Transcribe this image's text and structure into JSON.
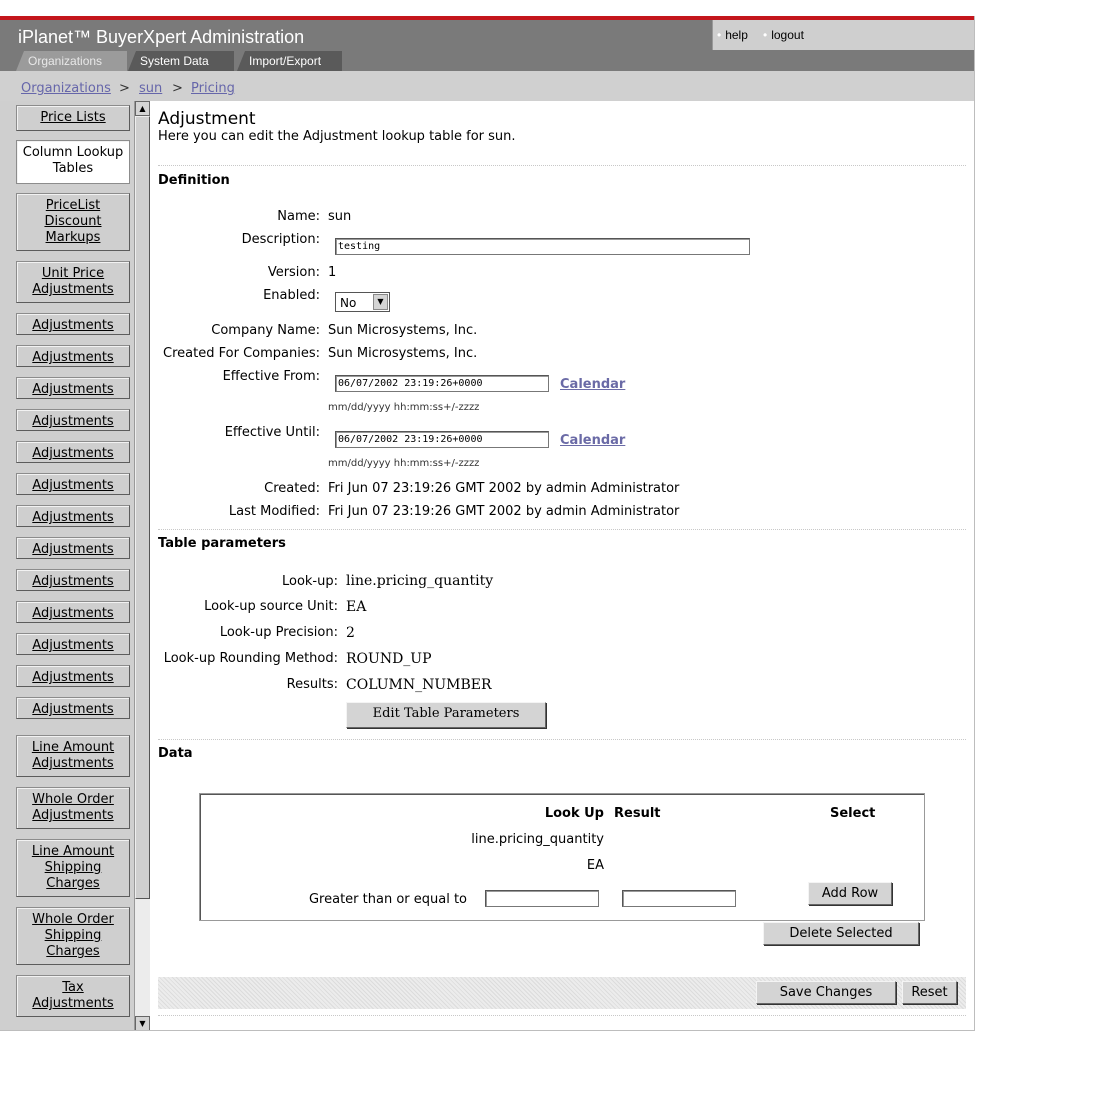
{
  "header": {
    "title": "iPlanet™ BuyerXpert Administration",
    "help": "help",
    "logout": "logout",
    "tabs": [
      "Organizations",
      "System Data",
      "Import/Export"
    ]
  },
  "breadcrumb": [
    "Organizations",
    "sun",
    "Pricing"
  ],
  "breadcrumb_sep": ">",
  "sidebar": [
    [
      "Price Lists"
    ],
    [
      "Column Lookup",
      "Tables"
    ],
    [
      "PriceList",
      "Discount",
      "Markups"
    ],
    [
      "Unit Price",
      "Adjustments"
    ],
    [
      "Adjustments"
    ],
    [
      "Adjustments"
    ],
    [
      "Adjustments"
    ],
    [
      "Adjustments"
    ],
    [
      "Adjustments"
    ],
    [
      "Adjustments"
    ],
    [
      "Adjustments"
    ],
    [
      "Adjustments"
    ],
    [
      "Adjustments"
    ],
    [
      "Adjustments"
    ],
    [
      "Adjustments"
    ],
    [
      "Adjustments"
    ],
    [
      "Adjustments"
    ],
    [
      "Line Amount",
      "Adjustments"
    ],
    [
      "Whole Order",
      "Adjustments"
    ],
    [
      "Line Amount",
      "Shipping",
      "Charges"
    ],
    [
      "Whole Order",
      "Shipping",
      "Charges"
    ],
    [
      "Tax",
      "Adjustments"
    ]
  ],
  "page": {
    "title": "Adjustment",
    "intro": "Here you can edit the Adjustment lookup table for sun."
  },
  "definition": {
    "heading": "Definition",
    "name_label": "Name:",
    "name": "sun",
    "description_label": "Description:",
    "description": "testing",
    "version_label": "Version:",
    "version": "1",
    "enabled_label": "Enabled:",
    "enabled": "No",
    "company_label": "Company Name:",
    "company": "Sun Microsystems, Inc.",
    "created_for_label": "Created For Companies:",
    "created_for": "Sun Microsystems, Inc.",
    "effective_from_label": "Effective From:",
    "effective_from": "06/07/2002 23:19:26+0000",
    "effective_until_label": "Effective Until:",
    "effective_until": "06/07/2002 23:19:26+0000",
    "date_hint": "mm/dd/yyyy hh:mm:ss+/-zzzz",
    "calendar_link": "Calendar",
    "created_label": "Created:",
    "created": "Fri Jun 07 23:19:26 GMT 2002 by admin Administrator",
    "modified_label": "Last Modified:",
    "modified": "Fri Jun 07 23:19:26 GMT 2002 by admin Administrator"
  },
  "table_params": {
    "heading": "Table parameters",
    "lookup_label": "Look-up:",
    "lookup": "line.pricing_quantity",
    "unit_label": "Look-up source Unit:",
    "unit": "EA",
    "precision_label": "Look-up Precision:",
    "precision": "2",
    "rounding_label": "Look-up Rounding Method:",
    "rounding": "ROUND_UP",
    "results_label": "Results:",
    "results": "COLUMN_NUMBER",
    "edit_button": "Edit Table Parameters"
  },
  "data": {
    "heading": "Data",
    "col_lookup": "Look Up",
    "col_result": "Result",
    "col_select": "Select",
    "lookup_field": "line.pricing_quantity",
    "lookup_unit": "EA",
    "condition": "Greater than or equal to",
    "add_row": "Add Row",
    "delete_selected": "Delete Selected"
  },
  "footer": {
    "save": "Save Changes",
    "reset": "Reset"
  }
}
